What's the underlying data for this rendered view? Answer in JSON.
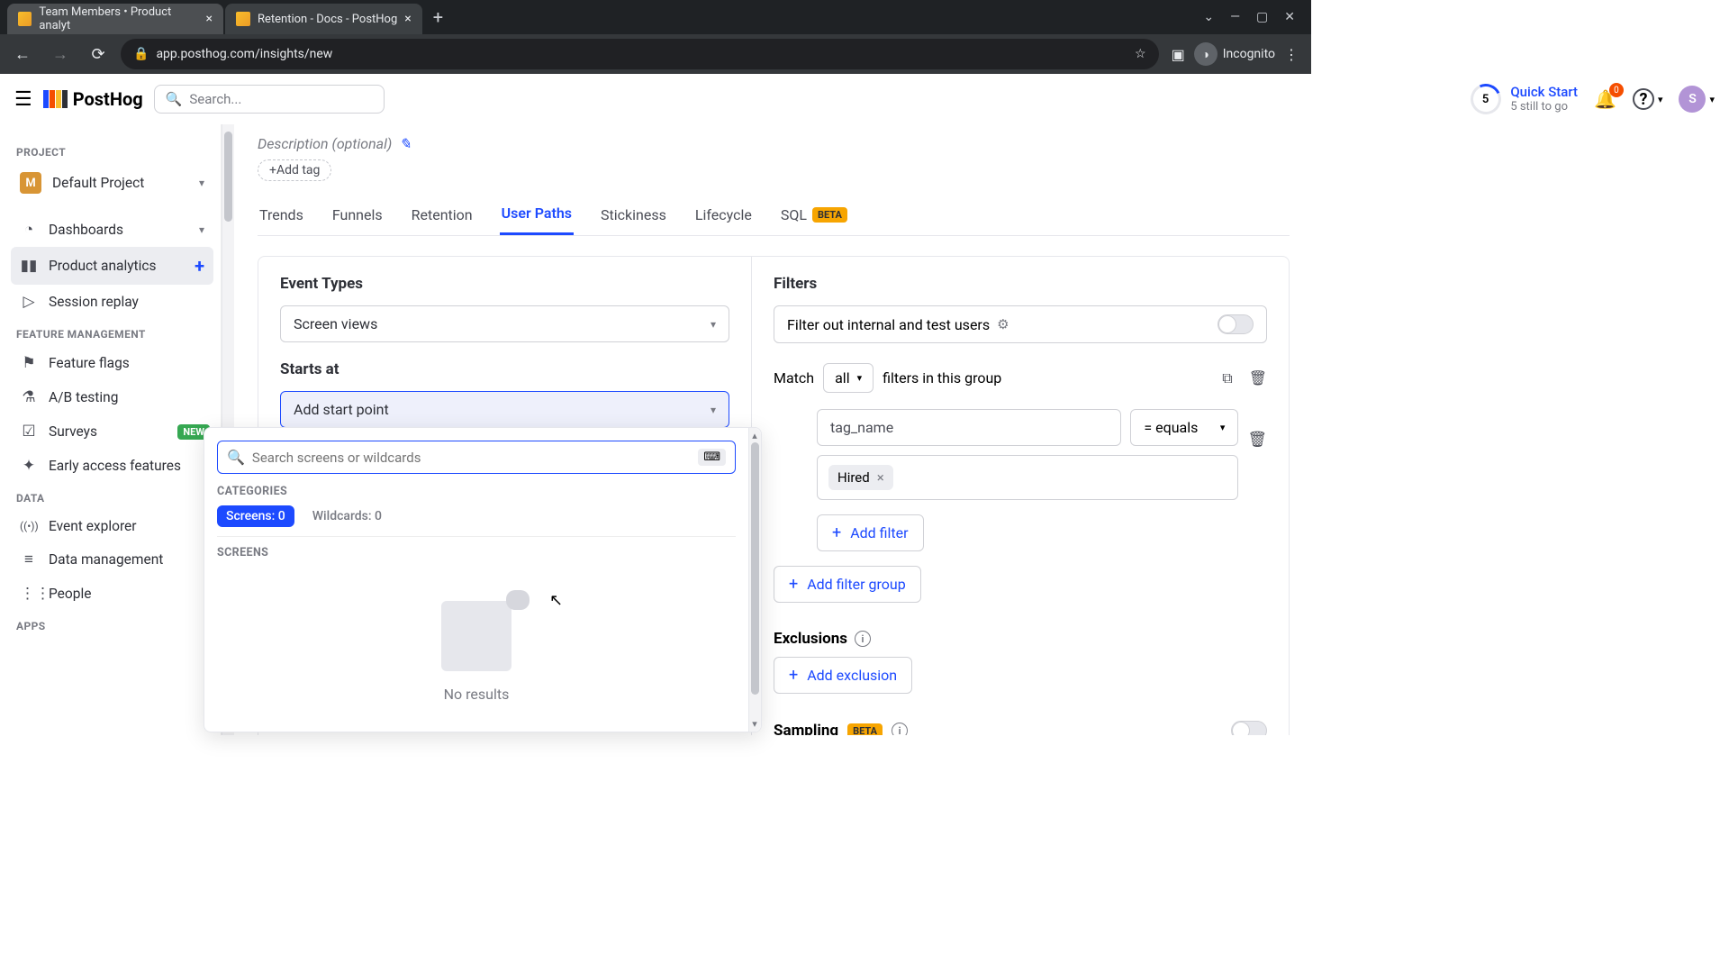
{
  "browser": {
    "tabs": [
      {
        "title": "Team Members • Product analyt",
        "active": true
      },
      {
        "title": "Retention - Docs - PostHog",
        "active": false
      }
    ],
    "url": "app.posthog.com/insights/new",
    "incognito": "Incognito"
  },
  "topbar": {
    "logo": "PostHog",
    "search_placeholder": "Search...",
    "quickstart": {
      "count": "5",
      "title": "Quick Start",
      "sub": "5 still to go"
    },
    "notif_count": "0",
    "user_initial": "S"
  },
  "sidebar": {
    "project_heading": "PROJECT",
    "project_initial": "M",
    "project_name": "Default Project",
    "items": [
      {
        "icon": "◔",
        "label": "Dashboards",
        "has_chev": true
      },
      {
        "icon": "▮▮",
        "label": "Product analytics",
        "has_plus": true,
        "active": true
      },
      {
        "icon": "▷",
        "label": "Session replay"
      }
    ],
    "feature_heading": "FEATURE MANAGEMENT",
    "feature_items": [
      {
        "icon": "⚑",
        "label": "Feature flags"
      },
      {
        "icon": "⚗",
        "label": "A/B testing"
      },
      {
        "icon": "☑",
        "label": "Surveys",
        "new": "NEW"
      },
      {
        "icon": "✦",
        "label": "Early access features"
      }
    ],
    "data_heading": "DATA",
    "data_items": [
      {
        "icon": "((•))",
        "label": "Event explorer"
      },
      {
        "icon": "≡",
        "label": "Data management"
      },
      {
        "icon": "⋮⋮",
        "label": "People"
      }
    ],
    "apps_heading": "APPS"
  },
  "main": {
    "description_placeholder": "Description (optional)",
    "add_tag": "Add tag",
    "tabs": [
      "Trends",
      "Funnels",
      "Retention",
      "User Paths",
      "Stickiness",
      "Lifecycle"
    ],
    "sql_tab": "SQL",
    "beta": "BETA",
    "active_tab": "User Paths",
    "event_types": {
      "label": "Event Types",
      "value": "Screen views"
    },
    "starts_at": {
      "label": "Starts at",
      "value": "Add start point"
    },
    "filters": {
      "label": "Filters",
      "toggle_label": "Filter out internal and test users",
      "match_text_pre": "Match",
      "match_mode": "all",
      "match_text_post": "filters in this group",
      "prop": "tag_name",
      "eq": "= equals",
      "chip": "Hired",
      "add_filter": "Add filter",
      "add_group": "Add filter group",
      "exclusions": "Exclusions",
      "add_exclusion": "Add exclusion",
      "sampling": "Sampling"
    }
  },
  "popover": {
    "search_placeholder": "Search screens or wildcards",
    "categories": "CATEGORIES",
    "screens_pill": "Screens: 0",
    "wildcards_pill": "Wildcards: 0",
    "screens_heading": "SCREENS",
    "empty": "No results"
  }
}
